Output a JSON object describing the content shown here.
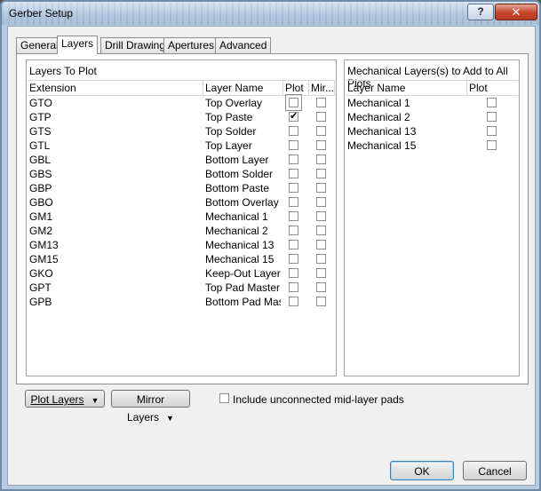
{
  "window": {
    "title": "Gerber Setup",
    "help_label": "?",
    "close_label": "✕"
  },
  "tabs": [
    {
      "label": "General",
      "active": false
    },
    {
      "label": "Layers",
      "active": true
    },
    {
      "label": "Drill Drawing",
      "active": false
    },
    {
      "label": "Apertures",
      "active": false
    },
    {
      "label": "Advanced",
      "active": false
    }
  ],
  "layers_group": {
    "title": "Layers To Plot",
    "columns": [
      "Extension",
      "Layer Name",
      "Plot",
      "Mir..."
    ],
    "rows": [
      {
        "ext": "GTO",
        "name": "Top Overlay",
        "plot": false,
        "mirror": false
      },
      {
        "ext": "GTP",
        "name": "Top Paste",
        "plot": true,
        "mirror": false
      },
      {
        "ext": "GTS",
        "name": "Top Solder",
        "plot": false,
        "mirror": false
      },
      {
        "ext": "GTL",
        "name": "Top Layer",
        "plot": false,
        "mirror": false
      },
      {
        "ext": "GBL",
        "name": "Bottom Layer",
        "plot": false,
        "mirror": false
      },
      {
        "ext": "GBS",
        "name": "Bottom Solder",
        "plot": false,
        "mirror": false
      },
      {
        "ext": "GBP",
        "name": "Bottom Paste",
        "plot": false,
        "mirror": false
      },
      {
        "ext": "GBO",
        "name": "Bottom Overlay",
        "plot": false,
        "mirror": false
      },
      {
        "ext": "GM1",
        "name": "Mechanical 1",
        "plot": false,
        "mirror": false
      },
      {
        "ext": "GM2",
        "name": "Mechanical 2",
        "plot": false,
        "mirror": false
      },
      {
        "ext": "GM13",
        "name": "Mechanical 13",
        "plot": false,
        "mirror": false
      },
      {
        "ext": "GM15",
        "name": "Mechanical 15",
        "plot": false,
        "mirror": false
      },
      {
        "ext": "GKO",
        "name": "Keep-Out Layer",
        "plot": false,
        "mirror": false
      },
      {
        "ext": "GPT",
        "name": "Top Pad Master",
        "plot": false,
        "mirror": false
      },
      {
        "ext": "GPB",
        "name": "Bottom Pad Maste",
        "plot": false,
        "mirror": false
      }
    ]
  },
  "mech_group": {
    "title": "Mechanical Layers(s) to Add to All Plots",
    "columns": [
      "Layer Name",
      "Plot"
    ],
    "rows": [
      {
        "name": "Mechanical 1",
        "plot": false
      },
      {
        "name": "Mechanical 2",
        "plot": false
      },
      {
        "name": "Mechanical 13",
        "plot": false
      },
      {
        "name": "Mechanical 15",
        "plot": false
      }
    ]
  },
  "buttons": {
    "plot_layers": "Plot Layers",
    "mirror_layers": "Mirror Layers",
    "ok": "OK",
    "cancel": "Cancel"
  },
  "options": {
    "include_unconnected": "Include unconnected mid-layer pads",
    "include_unconnected_checked": false
  }
}
